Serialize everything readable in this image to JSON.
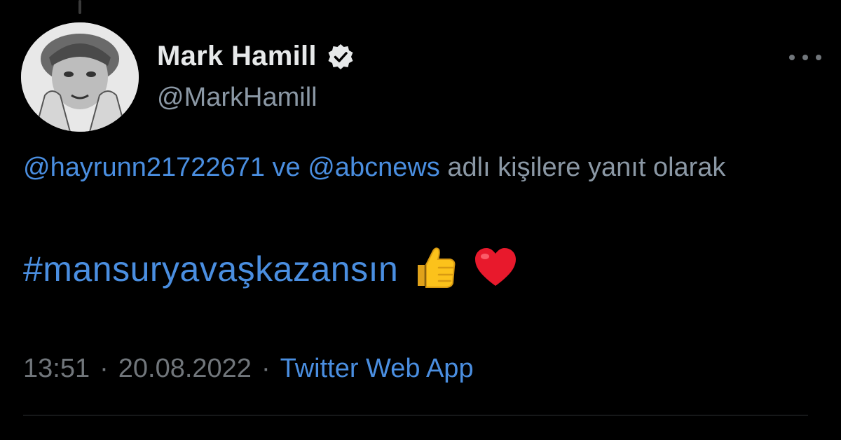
{
  "author": {
    "display_name": "Mark Hamill",
    "handle": "@MarkHamill",
    "verified": true
  },
  "reply_context": {
    "mention_1": "@hayrunn21722671",
    "connector": "ve",
    "mention_2": "@abcnews",
    "suffix": "adlı kişilere yanıt olarak"
  },
  "tweet": {
    "hashtag": "#mansuryavaşkazansın",
    "emojis": [
      "thumbs-up-icon",
      "red-heart-icon"
    ]
  },
  "meta": {
    "time": "13:51",
    "separator": "·",
    "date": "20.08.2022",
    "source": "Twitter Web App"
  },
  "colors": {
    "background": "#000000",
    "link": "#4a8ee0",
    "secondary": "#71767b",
    "primary_text": "#e7e9ea"
  }
}
